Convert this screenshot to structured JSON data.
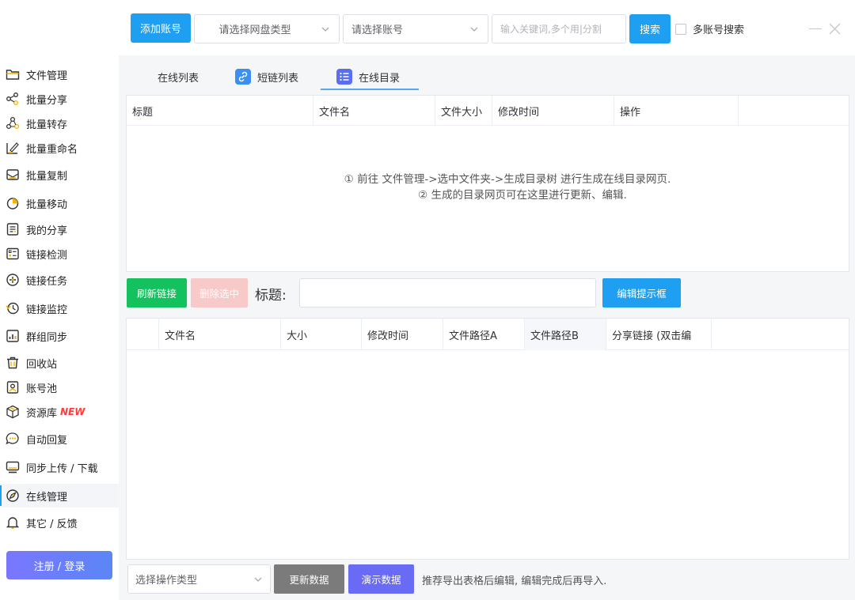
{
  "topbar": {
    "add_account_label": "添加账号",
    "disk_type_select": "请选择网盘类型",
    "account_select": "请选择账号",
    "keyword_placeholder": "输入关键词,多个用|分割",
    "search_label": "搜索",
    "multi_account_label": "多账号搜索"
  },
  "sidebar": {
    "items": [
      {
        "label": "文件管理",
        "icon": "folder-icon"
      },
      {
        "label": "批量分享",
        "icon": "share-icon"
      },
      {
        "label": "批量转存",
        "icon": "transfer-icon"
      },
      {
        "label": "批量重命名",
        "icon": "rename-icon"
      },
      {
        "label": "批量复制",
        "icon": "copy-icon"
      },
      {
        "label": "批量移动",
        "icon": "move-icon"
      },
      {
        "label": "我的分享",
        "icon": "my-share-icon"
      },
      {
        "label": "链接检测",
        "icon": "link-check-icon"
      },
      {
        "label": "链接任务",
        "icon": "link-task-icon"
      },
      {
        "label": "链接监控",
        "icon": "link-monitor-icon"
      },
      {
        "label": "群组同步",
        "icon": "group-sync-icon"
      },
      {
        "label": "回收站",
        "icon": "trash-icon"
      },
      {
        "label": "账号池",
        "icon": "account-pool-icon"
      },
      {
        "label": "资源库",
        "icon": "resource-icon",
        "badge": "NEW"
      },
      {
        "label": "自动回复",
        "icon": "auto-reply-icon"
      },
      {
        "label": "同步上传 / 下载",
        "icon": "sync-icon"
      },
      {
        "label": "在线管理",
        "icon": "compass-icon",
        "active": true
      },
      {
        "label": "其它 / 反馈",
        "icon": "bell-icon"
      }
    ],
    "login_label": "注册 / 登录"
  },
  "tabs": [
    {
      "label": "在线列表"
    },
    {
      "label": "短链列表"
    },
    {
      "label": "在线目录",
      "active": true
    }
  ],
  "top_table": {
    "columns": [
      "标题",
      "文件名",
      "文件大小",
      "修改时间",
      "操作",
      ""
    ],
    "notice_line1": "① 前往  文件管理->选中文件夹->生成目录树  进行生成在线目录网页.",
    "notice_line2": "② 生成的目录网页可在这里进行更新、编辑."
  },
  "toolbar": {
    "refresh_label": "刷新链接",
    "delete_label": "删除选中",
    "title_label": "标题:",
    "edit_tip_label": "编辑提示框"
  },
  "bottom_table": {
    "columns": [
      "",
      "文件名",
      "大小",
      "修改时间",
      "文件路径A",
      "文件路径B",
      "分享链接 (双击编",
      ""
    ]
  },
  "bottom_bar": {
    "op_select": "选择操作类型",
    "update_label": "更新数据",
    "demo_label": "演示数据",
    "hint": "推荐导出表格后编辑, 编辑完成后再导入."
  },
  "colors": {
    "accent": "#1e9ff2",
    "green": "#13c15f",
    "disabled_red": "#f7c9c9",
    "grey_button": "#7b7b7b",
    "purple_button": "#6a6bf5",
    "new_badge": "#ff3b3b"
  }
}
